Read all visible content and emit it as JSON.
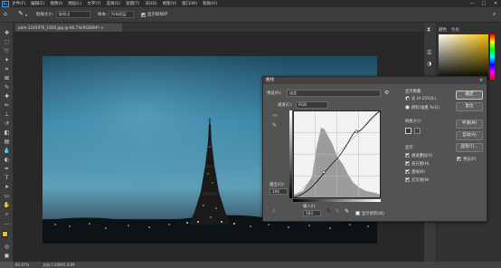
{
  "menubar": {
    "logo": "Ps",
    "items": [
      "文件(F)",
      "编辑(E)",
      "图像(I)",
      "图层(L)",
      "文字(Y)",
      "选择(S)",
      "滤镜(T)",
      "3D(D)",
      "视图(V)",
      "窗口(W)",
      "帮助(H)"
    ],
    "minimize": "—",
    "maximize": "□",
    "close": "✕"
  },
  "options": {
    "sample_size_label": "取样大小:",
    "sample_size_value": "取样点",
    "sample_label": "样本:",
    "sample_value": "所有图层",
    "show_ring_label": "显示取样环"
  },
  "document": {
    "tab_title": "pam-1245970_1920.jpg @ 66.7%(RGB/8#) ×"
  },
  "status": {
    "zoom": "66.67%",
    "doc_size": "文档:5.93M/5.93M"
  },
  "right_panel": {
    "tab1": "颜色",
    "tab2": "色板",
    "fg_color": "#e8c020",
    "bg_color": "#ffffff"
  },
  "tooltip": "曲线",
  "curves_dialog": {
    "title": "曲线",
    "preset_label": "预设(R):",
    "preset_value": "自定",
    "channel_label": "通道(C):",
    "channel_value": "RGB",
    "output_label": "输出(O):",
    "output_value": "196",
    "input_label": "输入(I):",
    "input_value": "183",
    "show_clipping_label": "显示修剪(W)",
    "amount_label": "显示数量:",
    "light_option": "光 (0-255)(L)",
    "pigment_option": "颜料/油墨 %(G)",
    "grid_size_label": "网格大小:",
    "show_label": "显示:",
    "show_options": [
      "通道叠加(V)",
      "直方图(H)",
      "基线(B)",
      "交叉线(N)"
    ],
    "ok_button": "确定",
    "reset_button": "复位",
    "smooth_button": "平滑(M)",
    "auto_button": "自动(A)",
    "options_button": "选项(T)...",
    "preview_label": "预览(P)"
  }
}
